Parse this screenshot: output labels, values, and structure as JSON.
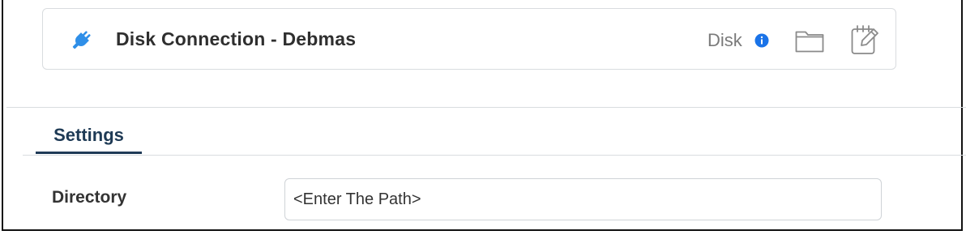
{
  "connection": {
    "title": "Disk Connection - Debmas",
    "type_label": "Disk",
    "icons": {
      "connector": "plug-icon",
      "info": "info-icon",
      "browse": "folder-icon",
      "edit": "edit-note-icon"
    },
    "colors": {
      "plug": "#2f8fe8",
      "info": "#1a73e8"
    }
  },
  "tabs": [
    {
      "label": "Settings",
      "active": true
    }
  ],
  "settings": {
    "directory_label": "Directory",
    "directory_value": "",
    "directory_placeholder": "<Enter The Path>"
  },
  "theme": {
    "active_tab_color": "#1f3a57",
    "border_color": "#d9dcdf"
  }
}
